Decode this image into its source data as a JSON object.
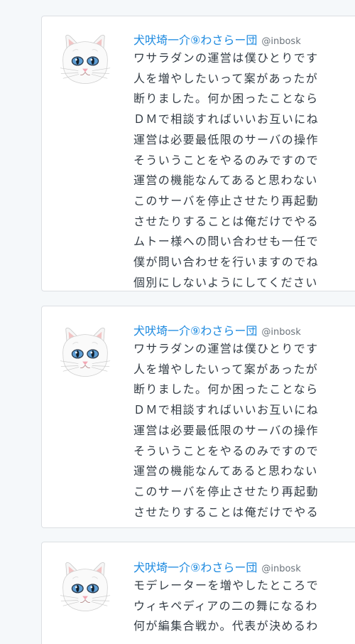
{
  "posts": [
    {
      "display_name": "犬吠埼一介⑨わさらー団",
      "handle": "@inbosk",
      "lines": [
        "ワサラダンの運営は僕ひとりです",
        "人を増やしたいって案があったが",
        "断りました。何か困ったことなら",
        "ＤＭで相談すればいいお互いにね",
        "運営は必要最低限のサーバの操作",
        "そういうことをやるのみですので",
        "運営の機能なんてあると思わない",
        "このサーバを停止させたり再起動",
        "させたりすることは俺だけでやる",
        "ムトー様への問い合わせも一任で",
        "僕が問い合わせを行いますのでね",
        "個別にしないようにしてください"
      ]
    },
    {
      "display_name": "犬吠埼一介⑨わさらー団",
      "handle": "@inbosk",
      "lines": [
        "ワサラダンの運営は僕ひとりです",
        "人を増やしたいって案があったが",
        "断りました。何か困ったことなら",
        "ＤＭで相談すればいいお互いにね",
        "運営は必要最低限のサーバの操作",
        "そういうことをやるのみですので",
        "運営の機能なんてあると思わない",
        "このサーバを停止させたり再起動",
        "させたりすることは俺だけでやる"
      ]
    },
    {
      "display_name": "犬吠埼一介⑨わさらー団",
      "handle": "@inbosk",
      "lines": [
        "モデレーターを増やしたところで",
        "ウィキペディアの二の舞になるわ",
        "何が編集合戦か。代表が決めるわ"
      ]
    }
  ],
  "colors": {
    "background": "#f5f8fa",
    "card": "#ffffff",
    "border": "#dcdfe3",
    "name": "#1d8ae0",
    "handle": "#6b737b",
    "text": "#333c45"
  },
  "icons": {
    "avatar": "white-cat-avatar-icon"
  }
}
